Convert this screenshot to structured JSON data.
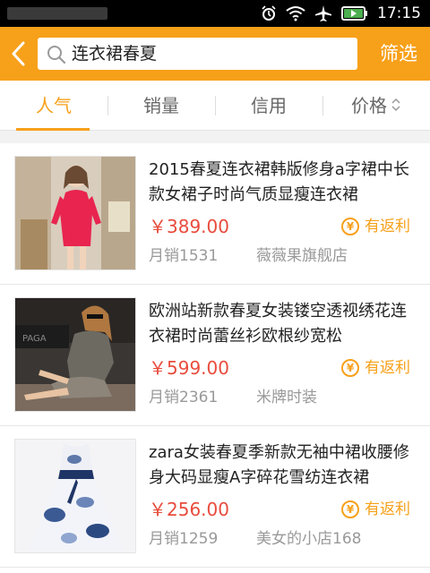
{
  "status_bar": {
    "time": "17:15",
    "icons": [
      "alarm-icon",
      "wifi-icon",
      "airplane-icon",
      "battery-icon"
    ]
  },
  "header": {
    "search_text": "连衣裙春夏",
    "filter_label": "筛选",
    "accent_color": "#f7a01a"
  },
  "tabs": [
    {
      "label": "人气",
      "active": true
    },
    {
      "label": "销量",
      "active": false
    },
    {
      "label": "信用",
      "active": false
    },
    {
      "label": "价格",
      "active": false
    }
  ],
  "products": [
    {
      "title": "2015春夏连衣裙韩版修身a字裙中长款女裙子时尚气质显瘦连衣裙",
      "price": "￥389.00",
      "rebate": "有返利",
      "sales": "月销1531",
      "shop": "薇薇果旗舰店",
      "image": "red-dress-photo"
    },
    {
      "title": "欧洲站新款春夏女装镂空透视绣花连衣裙时尚蕾丝衫欧根纱宽松",
      "price": "￥599.00",
      "rebate": "有返利",
      "sales": "月销2361",
      "shop": "米牌时装",
      "image": "lace-dress-photo"
    },
    {
      "title": "zara女装春夏季新款无袖中裙收腰修身大码显瘦A字碎花雪纺连衣裙",
      "price": "￥256.00",
      "rebate": "有返利",
      "sales": "月销1259",
      "shop": "美女的小店168",
      "image": "floral-dress-photo"
    }
  ]
}
